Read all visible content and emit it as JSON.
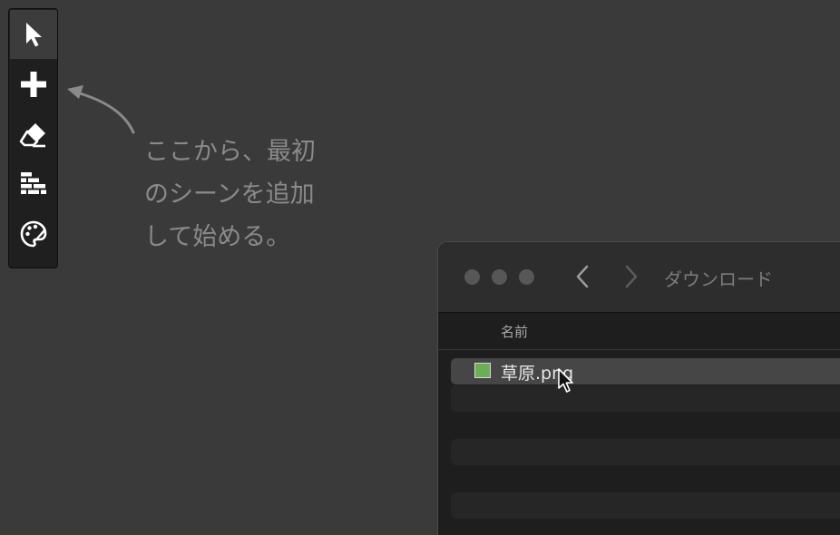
{
  "toolbar": {
    "tools": [
      {
        "name": "select",
        "icon": "arrow-pointer-icon",
        "active": true
      },
      {
        "name": "add",
        "icon": "plus-icon",
        "active": false
      },
      {
        "name": "erase",
        "icon": "eraser-icon",
        "active": false
      },
      {
        "name": "layers",
        "icon": "bricks-icon",
        "active": false
      },
      {
        "name": "style",
        "icon": "palette-icon",
        "active": false
      }
    ]
  },
  "hint": {
    "lines": [
      "ここから、最初",
      "のシーンを追加",
      "して始める。"
    ],
    "arrow_icon": "curved-arrow-icon"
  },
  "finder": {
    "title": "ダウンロード",
    "nav": {
      "back_icon": "chevron-left-icon",
      "forward_icon": "chevron-right-icon"
    },
    "column_header": "名前",
    "files": [
      {
        "name": "草原.png",
        "icon": "image-file-icon",
        "selected": true
      }
    ]
  },
  "colors": {
    "background": "#3a3a3a",
    "toolbar": "#1f1f1f",
    "hint_text": "#8a8a8a",
    "thumb_green": "#6cae58"
  }
}
